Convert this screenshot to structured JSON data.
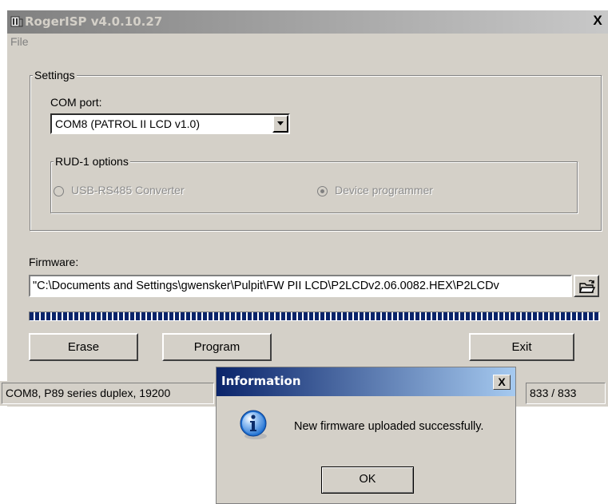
{
  "window": {
    "title": "RogerISP v4.0.10.27",
    "close_glyph": "X"
  },
  "menu": {
    "file": "File"
  },
  "settings": {
    "legend": "Settings",
    "com_port_label": "COM port:",
    "com_port_value": "COM8 (PATROL II LCD v1.0)",
    "rud_legend": "RUD-1 options",
    "radio_usb": "USB-RS485 Converter",
    "radio_device": "Device programmer",
    "selected_radio": "device"
  },
  "firmware": {
    "label": "Firmware:",
    "path": "\"C:\\Documents and Settings\\gwensker\\Pulpit\\FW PII LCD\\P2LCDv2.06.0082.HEX\\P2LCDv"
  },
  "progress": {
    "percent": 100
  },
  "buttons": {
    "erase": "Erase",
    "program": "Program",
    "exit": "Exit"
  },
  "status": {
    "left": "COM8, P89 series duplex, 19200",
    "right": "833 / 833"
  },
  "dialog": {
    "title": "Information",
    "close_glyph": "X",
    "message": "New firmware uploaded successfully.",
    "ok": "OK",
    "icon": "info-icon"
  },
  "colors": {
    "dialog_title": "#0a246a",
    "progress": "#0a246a",
    "face": "#d4d0c8"
  }
}
